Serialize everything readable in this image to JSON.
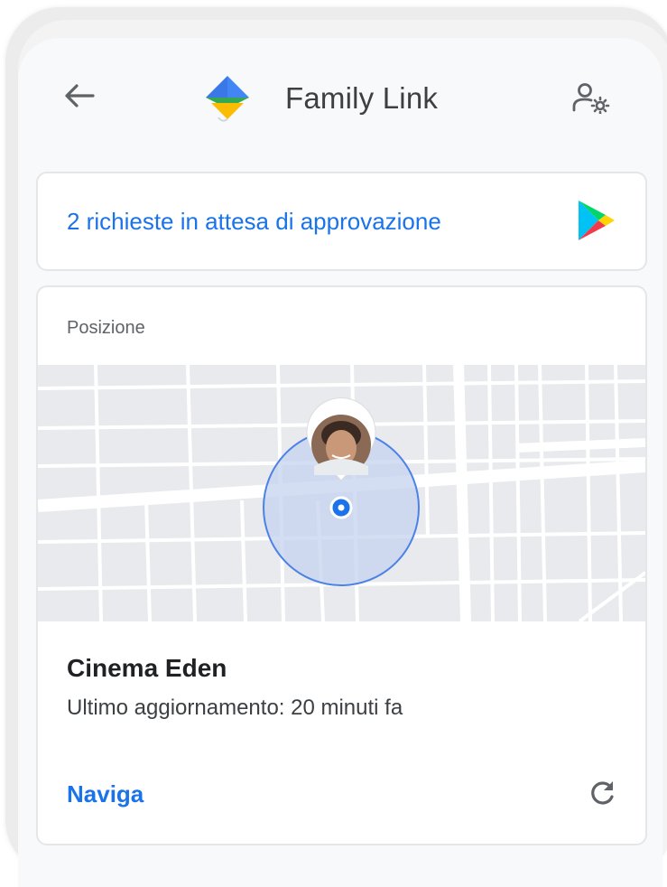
{
  "appbar": {
    "back_icon": "arrow-back-icon",
    "logo_icon": "family-link-kite-logo",
    "title": "Family Link",
    "settings_icon": "manage-account-settings-icon"
  },
  "requests_card": {
    "text": "2 richieste in attesa di approvazione",
    "icon": "google-play-icon"
  },
  "location_card": {
    "section_label": "Posizione",
    "map": {
      "avatar": "child-avatar-photo",
      "marker": "location-dot",
      "accuracy_circle": true
    },
    "place_name": "Cinema Eden",
    "updated": "Ultimo aggiornamento: 20 minuti fa",
    "navigate_label": "Naviga",
    "refresh_icon": "refresh-icon"
  },
  "colors": {
    "accent": "#1a73e8",
    "text_primary": "#202124",
    "text_secondary": "#5f6368",
    "map_background": "#e8eaed",
    "accuracy_fill": "#c5d3ef"
  }
}
